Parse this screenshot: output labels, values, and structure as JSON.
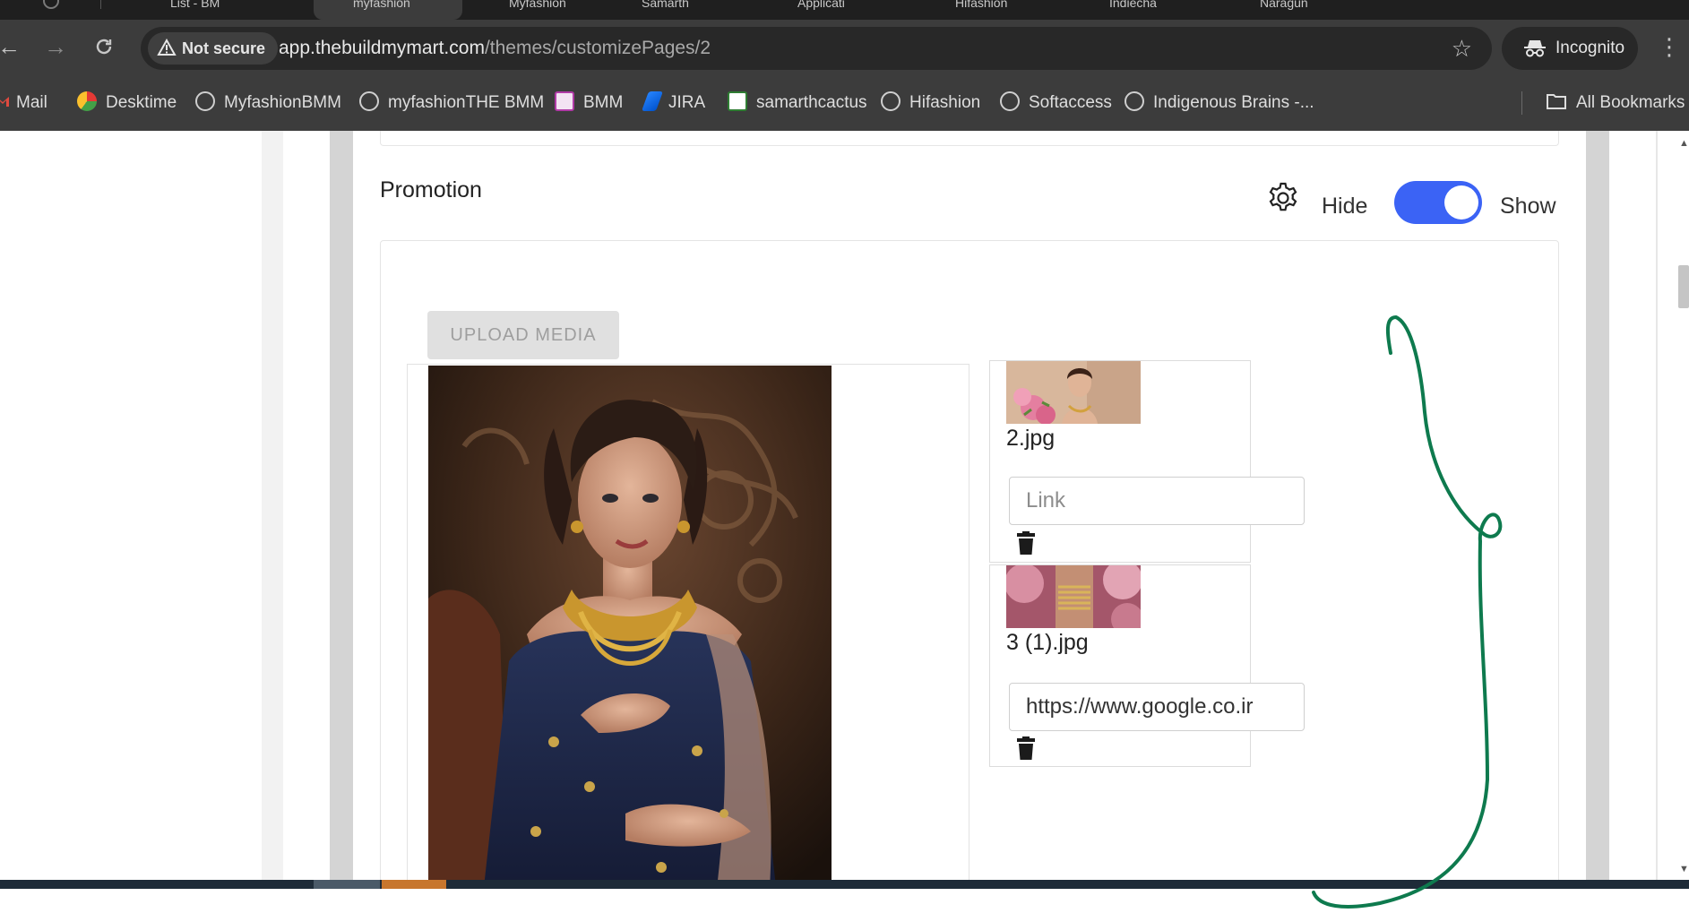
{
  "browser": {
    "tabs": [
      {
        "label": ""
      },
      {
        "label": "List - BM"
      },
      {
        "label": "myfashion"
      },
      {
        "label": "Myfashion"
      },
      {
        "label": "Samarth"
      },
      {
        "label": "Applicati"
      },
      {
        "label": "Hifashion"
      },
      {
        "label": "Indiecha"
      },
      {
        "label": "Naragun"
      }
    ],
    "security_chip": "Not secure",
    "url_host": "app.thebuildmymart.com",
    "url_path": "/themes/customizePages/2",
    "incognito_label": "Incognito",
    "bookmarks": [
      {
        "label": "Mail",
        "icon": "gmail-icon"
      },
      {
        "label": "Desktime",
        "icon": "desktime-icon"
      },
      {
        "label": "MyfashionBMM",
        "icon": "globe-icon"
      },
      {
        "label": "myfashionTHE BMM",
        "icon": "globe-icon"
      },
      {
        "label": "BMM",
        "icon": "bmm-icon"
      },
      {
        "label": "JIRA",
        "icon": "jira-icon"
      },
      {
        "label": "samarthcactus",
        "icon": "cactus-icon"
      },
      {
        "label": "Hifashion",
        "icon": "globe-icon"
      },
      {
        "label": "Softaccess",
        "icon": "globe-icon"
      },
      {
        "label": "Indigenous Brains -...",
        "icon": "globe-icon"
      }
    ],
    "all_bookmarks": "All Bookmarks"
  },
  "section": {
    "title": "Promotion",
    "hide_label": "Hide",
    "show_label": "Show",
    "toggle_on": true,
    "accent_color": "#3b63f5"
  },
  "upload": {
    "button_label": "UPLOAD MEDIA"
  },
  "media_items": [
    {
      "file_name": "2.jpg",
      "link_value": "",
      "link_placeholder": "Link"
    },
    {
      "file_name": "3 (1).jpg",
      "link_value": "https://www.google.co.ir",
      "link_placeholder": "Link"
    }
  ],
  "annotation_color": "#0e7a4e"
}
